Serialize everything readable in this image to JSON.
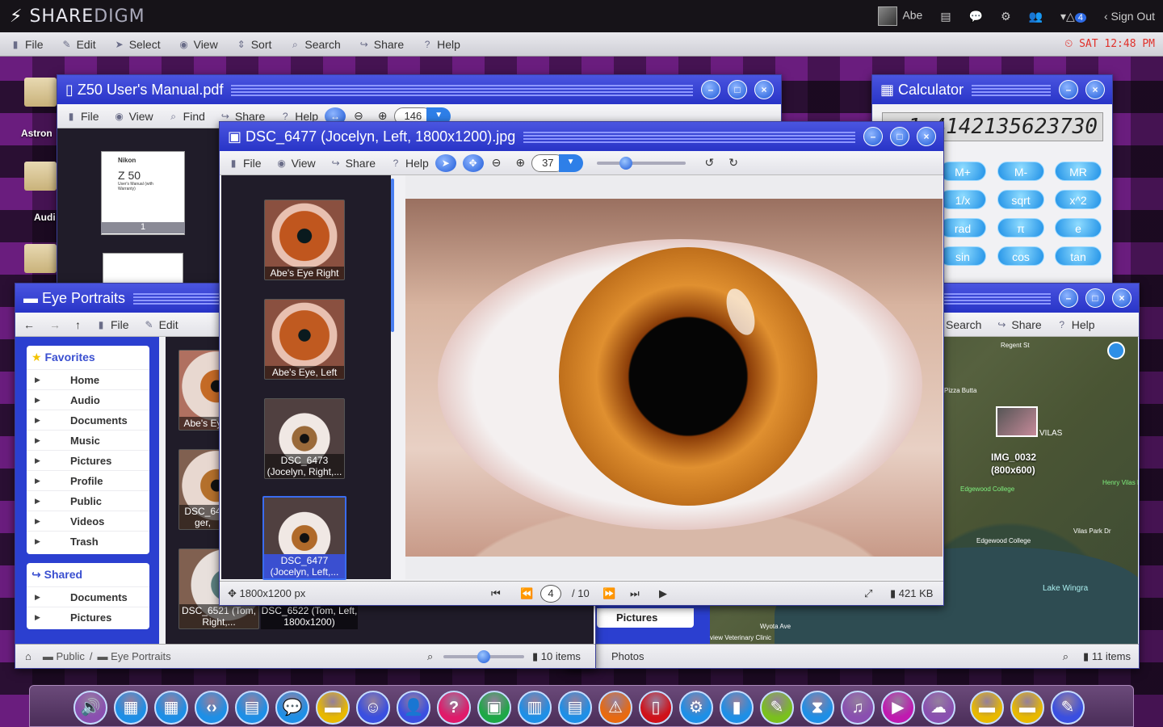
{
  "topbar": {
    "logo_main": "SHARE",
    "logo_sub": "DIGM",
    "user": "Abe",
    "notification_count": "4",
    "sign_out": "Sign Out"
  },
  "menubar": {
    "items": [
      "File",
      "Edit",
      "Select",
      "View",
      "Sort",
      "Search",
      "Share",
      "Help"
    ],
    "clock": "SAT 12:48 PM"
  },
  "desktop": {
    "icons": [
      "Astron",
      "Audi"
    ]
  },
  "pdf_window": {
    "title": "Z50 User's Manual.pdf",
    "toolbar": [
      "File",
      "View",
      "Find",
      "Share",
      "Help"
    ],
    "zoom": "146",
    "page_label": "1",
    "cover_brand": "Nikon",
    "cover_model": "Z 50",
    "cover_subtitle": "User's Manual (with Warranty)"
  },
  "calculator": {
    "title": "Calculator",
    "display": "1.4142135623730",
    "buttons": [
      [
        "M+",
        "M-",
        "MR"
      ],
      [
        "1/x",
        "sqrt",
        "x^2"
      ],
      [
        "rad",
        "π",
        "e"
      ],
      [
        "sin",
        "cos",
        "tan"
      ]
    ]
  },
  "image_viewer": {
    "title": "DSC_6477 (Jocelyn, Left, 1800x1200).jpg",
    "toolbar": [
      "File",
      "View",
      "Share",
      "Help"
    ],
    "zoom": "37",
    "thumbnails": [
      {
        "caption": "Abe's Eye Right",
        "color": "#c0561e"
      },
      {
        "caption": "Abe's Eye, Left",
        "color": "#c05a20"
      },
      {
        "caption": "DSC_6473 (Jocelyn, Right,...",
        "color": "#9a6a3a"
      },
      {
        "caption": "DSC_6477 (Jocelyn, Left,...",
        "color": "#b06a2a"
      }
    ],
    "dimensions": "1800x1200 px",
    "current_page": "4",
    "total_pages": "/ 10",
    "file_size": "421 KB"
  },
  "explorer": {
    "title": "Eye Portraits",
    "toolbar": [
      "File",
      "Edit"
    ],
    "favorites_label": "Favorites",
    "favorites": [
      "Home",
      "Audio",
      "Documents",
      "Music",
      "Pictures",
      "Profile",
      "Public",
      "Videos",
      "Trash"
    ],
    "shared_label": "Shared",
    "shared": [
      "Documents",
      "Pictures"
    ],
    "thumbnails": [
      "Abe's Ey",
      "DSC_64 ger,",
      "DSC_6521 (Tom, Right,...",
      "DSC_6522 (Tom, Left, 1800x1200)"
    ],
    "breadcrumb": [
      "Public",
      "Eye Portraits"
    ],
    "item_count": "10 items"
  },
  "map_window": {
    "toolbar": [
      "Search",
      "Share",
      "Help"
    ],
    "sidebar_item": "Pictures",
    "pin_label": "IMG_0032",
    "pin_size": "(800x600)",
    "map_labels": [
      "Regent St",
      "Pizza Butta",
      "VILAS",
      "Edgewood College",
      "Henry Vilas Par",
      "Lake Wingra",
      "Vilas Park Dr",
      "Edgewood College",
      "Wyota Ave",
      "view Veterinary Clinic"
    ],
    "status_path": "Photos",
    "item_count": "11 items"
  },
  "dock": {
    "icons": [
      "volume-icon",
      "calculator-icon",
      "calendar-icon",
      "code-icon",
      "contact-card-icon",
      "chat-icon",
      "folder-icon",
      "smiley-icon",
      "user-icon",
      "help-icon",
      "photos-icon",
      "map-icon",
      "news-icon",
      "warning-icon",
      "pdf-icon",
      "settings-icon",
      "document-icon",
      "paint-icon",
      "hourglass-icon",
      "music-icon",
      "video-icon",
      "cloud-icon",
      "folder-icon",
      "folder-icon",
      "brush-icon"
    ]
  }
}
